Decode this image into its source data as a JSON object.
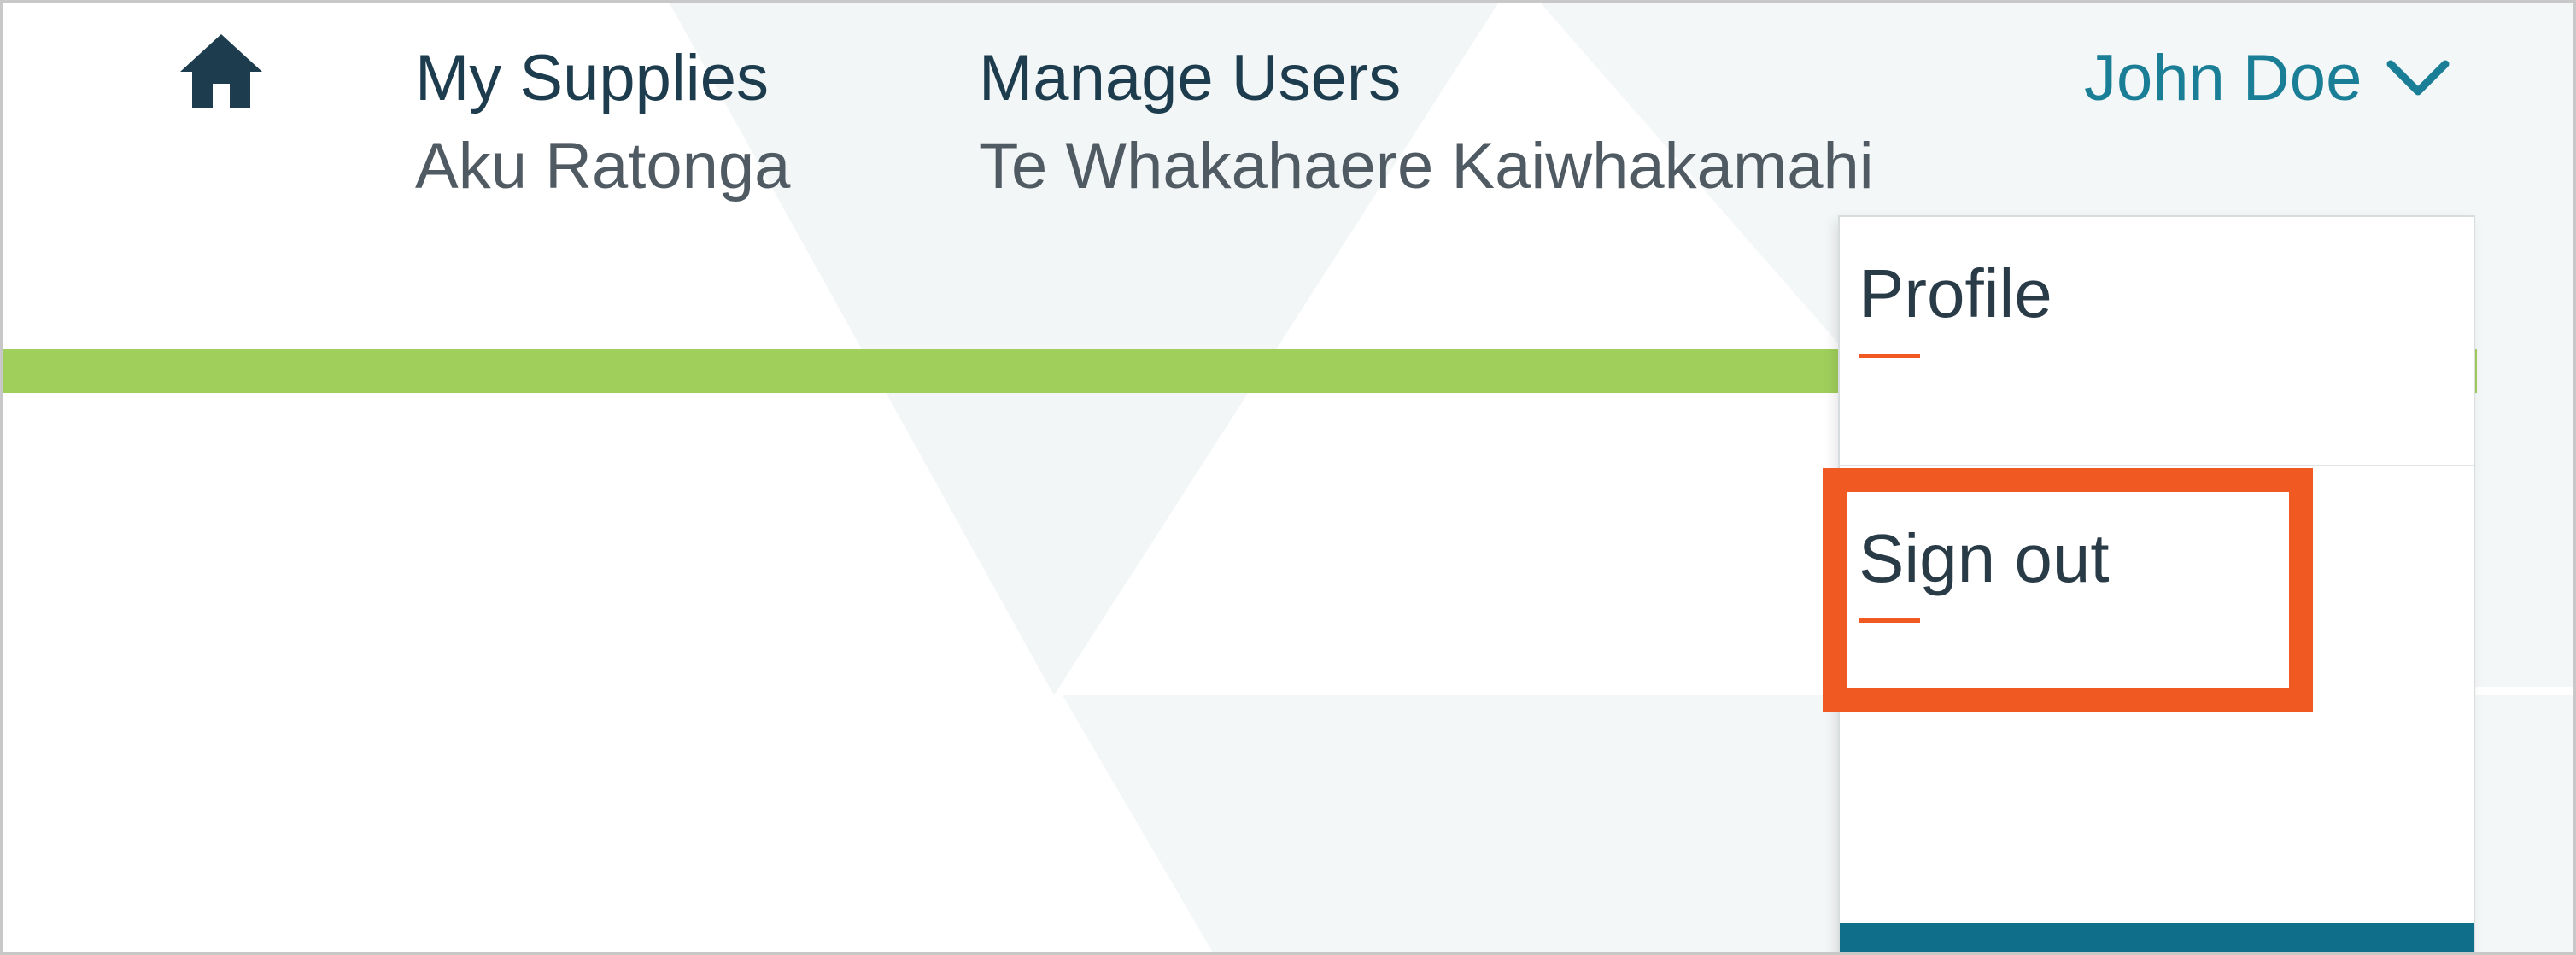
{
  "nav": {
    "home_icon": "home-icon",
    "items": [
      {
        "label": "My Supplies",
        "sublabel": "Aku Ratonga"
      },
      {
        "label": "Manage Users",
        "sublabel": "Te Whakahaere Kaiwhakamahi"
      }
    ],
    "user": {
      "name": "John Doe",
      "chevron_icon": "chevron-down-icon"
    }
  },
  "dropdown": {
    "items": [
      {
        "label": "Profile"
      },
      {
        "label": "Sign out"
      }
    ]
  },
  "colors": {
    "nav_text": "#1d3c4e",
    "user_accent": "#1a7f96",
    "green_bar": "#a1cf5c",
    "menu_accent": "#f05a22",
    "highlight": "#f05a22",
    "dropdown_footer": "#0f6f8b"
  }
}
